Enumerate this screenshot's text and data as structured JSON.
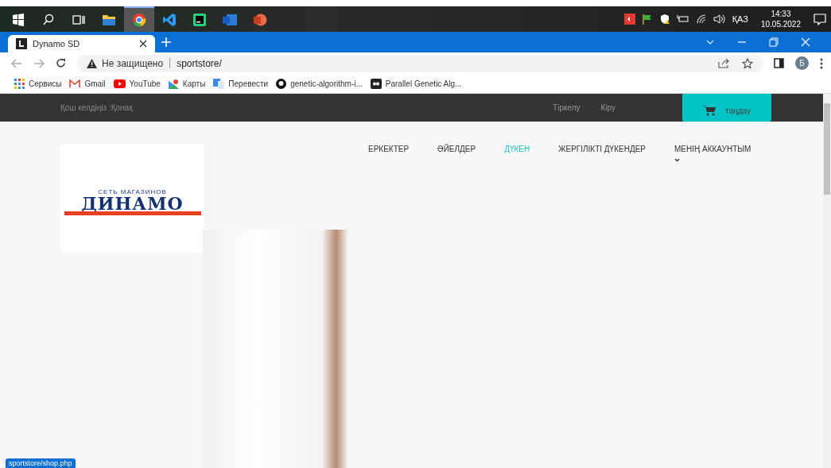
{
  "taskbar": {
    "apps": [
      {
        "kind": "start",
        "selected": false
      },
      {
        "kind": "search",
        "selected": false
      },
      {
        "kind": "taskview",
        "selected": false
      },
      {
        "kind": "folder",
        "selected": false
      },
      {
        "kind": "browser",
        "selected": true
      },
      {
        "kind": "code",
        "selected": false
      },
      {
        "kind": "ide",
        "selected": false
      },
      {
        "kind": "word",
        "selected": false
      },
      {
        "kind": "slides",
        "selected": false
      }
    ],
    "language": "ҚАЗ",
    "time": "14:33",
    "date": "10.05.2022"
  },
  "browser": {
    "tab_title": "Dynamo SD",
    "security": "Не защищено",
    "url": "sportstore/",
    "profile": "Б",
    "bookmarks": [
      {
        "kind": "apps",
        "label": "Сервисы"
      },
      {
        "kind": "mail",
        "label": "Gmail"
      },
      {
        "kind": "video",
        "label": "YouTube"
      },
      {
        "kind": "maps",
        "label": "Карты"
      },
      {
        "kind": "translate",
        "label": "Перевести"
      },
      {
        "kind": "github",
        "label": "genetic-algorithm-i..."
      },
      {
        "kind": "dark",
        "label": "Parallel Genetic Alg..."
      }
    ]
  },
  "site": {
    "welcome": "Қош келдіңіз :Қонақ",
    "top_links": [
      "Тіркелу",
      "Кіру"
    ],
    "cart_button": "таңдау",
    "logo": {
      "tagline": "СЕТЬ МАГАЗИНОВ",
      "name": "ДИНАМО"
    },
    "nav": [
      {
        "label": "ЕРКЕКТЕР",
        "selected": false,
        "dropdown": false
      },
      {
        "label": "ӘЙЕЛДЕР",
        "selected": false,
        "dropdown": false
      },
      {
        "label": "ДҮКЕН",
        "selected": true,
        "dropdown": false
      },
      {
        "label": "ЖЕРГІЛІКТІ ДҮКЕНДЕР",
        "selected": false,
        "dropdown": false
      },
      {
        "label": "МЕНІҢ АККАУНТЫМ",
        "selected": false,
        "dropdown": true
      }
    ]
  },
  "status_url": "sportstore/shop.php"
}
